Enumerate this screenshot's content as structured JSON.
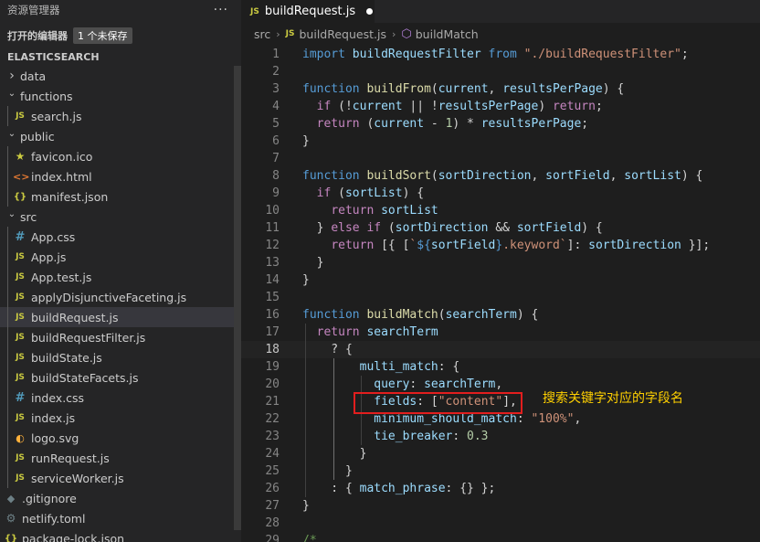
{
  "sidebar": {
    "title": "资源管理器",
    "more": "···",
    "open_editors": "打开的编辑器",
    "unsaved_badge": "1 个未保存",
    "project": "ELASTICSEARCH",
    "items": [
      {
        "label": "data",
        "type": "folder",
        "open": false,
        "depth": 0
      },
      {
        "label": "functions",
        "type": "folder",
        "open": true,
        "depth": 0
      },
      {
        "label": "search.js",
        "type": "js",
        "depth": 1
      },
      {
        "label": "public",
        "type": "folder",
        "open": true,
        "depth": 0
      },
      {
        "label": "favicon.ico",
        "type": "star",
        "depth": 1
      },
      {
        "label": "index.html",
        "type": "html",
        "depth": 1
      },
      {
        "label": "manifest.json",
        "type": "json",
        "depth": 1
      },
      {
        "label": "src",
        "type": "folder",
        "open": true,
        "depth": 0
      },
      {
        "label": "App.css",
        "type": "css",
        "depth": 1
      },
      {
        "label": "App.js",
        "type": "js",
        "depth": 1
      },
      {
        "label": "App.test.js",
        "type": "js",
        "depth": 1
      },
      {
        "label": "applyDisjunctiveFaceting.js",
        "type": "js",
        "depth": 1
      },
      {
        "label": "buildRequest.js",
        "type": "js",
        "depth": 1,
        "selected": true
      },
      {
        "label": "buildRequestFilter.js",
        "type": "js",
        "depth": 1
      },
      {
        "label": "buildState.js",
        "type": "js",
        "depth": 1
      },
      {
        "label": "buildStateFacets.js",
        "type": "js",
        "depth": 1
      },
      {
        "label": "index.css",
        "type": "css",
        "depth": 1
      },
      {
        "label": "index.js",
        "type": "js",
        "depth": 1
      },
      {
        "label": "logo.svg",
        "type": "svg",
        "depth": 1
      },
      {
        "label": "runRequest.js",
        "type": "js",
        "depth": 1
      },
      {
        "label": "serviceWorker.js",
        "type": "js",
        "depth": 1
      },
      {
        "label": ".gitignore",
        "type": "git",
        "depth": 0
      },
      {
        "label": "netlify.toml",
        "type": "gear",
        "depth": 0
      },
      {
        "label": "package-lock.json",
        "type": "json",
        "depth": 0
      }
    ]
  },
  "editor": {
    "tab_label": "buildRequest.js",
    "breadcrumb": [
      "src",
      "buildRequest.js",
      "buildMatch"
    ],
    "current_line": 18,
    "annotation": "搜索关键字对应的字段名",
    "lines": [
      [
        [
          "kw",
          "import"
        ],
        [
          "pl",
          " "
        ],
        [
          "var",
          "buildRequestFilter"
        ],
        [
          "pl",
          " "
        ],
        [
          "kw",
          "from"
        ],
        [
          "pl",
          " "
        ],
        [
          "str",
          "\"./buildRequestFilter\""
        ],
        [
          "pl",
          ";"
        ]
      ],
      [],
      [
        [
          "kw",
          "function"
        ],
        [
          "pl",
          " "
        ],
        [
          "fn",
          "buildFrom"
        ],
        [
          "pl",
          "("
        ],
        [
          "var",
          "current"
        ],
        [
          "pl",
          ", "
        ],
        [
          "var",
          "resultsPerPage"
        ],
        [
          "pl",
          ") {"
        ]
      ],
      [
        [
          "pl",
          "  "
        ],
        [
          "cf",
          "if"
        ],
        [
          "pl",
          " (!"
        ],
        [
          "var",
          "current"
        ],
        [
          "pl",
          " || !"
        ],
        [
          "var",
          "resultsPerPage"
        ],
        [
          "pl",
          ") "
        ],
        [
          "cf",
          "return"
        ],
        [
          "pl",
          ";"
        ]
      ],
      [
        [
          "pl",
          "  "
        ],
        [
          "cf",
          "return"
        ],
        [
          "pl",
          " ("
        ],
        [
          "var",
          "current"
        ],
        [
          "pl",
          " - "
        ],
        [
          "num",
          "1"
        ],
        [
          "pl",
          ") * "
        ],
        [
          "var",
          "resultsPerPage"
        ],
        [
          "pl",
          ";"
        ]
      ],
      [
        [
          "pl",
          "}"
        ]
      ],
      [],
      [
        [
          "kw",
          "function"
        ],
        [
          "pl",
          " "
        ],
        [
          "fn",
          "buildSort"
        ],
        [
          "pl",
          "("
        ],
        [
          "var",
          "sortDirection"
        ],
        [
          "pl",
          ", "
        ],
        [
          "var",
          "sortField"
        ],
        [
          "pl",
          ", "
        ],
        [
          "var",
          "sortList"
        ],
        [
          "pl",
          ") {"
        ]
      ],
      [
        [
          "pl",
          "  "
        ],
        [
          "cf",
          "if"
        ],
        [
          "pl",
          " ("
        ],
        [
          "var",
          "sortList"
        ],
        [
          "pl",
          ") {"
        ]
      ],
      [
        [
          "pl",
          "    "
        ],
        [
          "cf",
          "return"
        ],
        [
          "pl",
          " "
        ],
        [
          "var",
          "sortList"
        ]
      ],
      [
        [
          "pl",
          "  } "
        ],
        [
          "cf",
          "else"
        ],
        [
          "pl",
          " "
        ],
        [
          "cf",
          "if"
        ],
        [
          "pl",
          " ("
        ],
        [
          "var",
          "sortDirection"
        ],
        [
          "pl",
          " && "
        ],
        [
          "var",
          "sortField"
        ],
        [
          "pl",
          ") {"
        ]
      ],
      [
        [
          "pl",
          "    "
        ],
        [
          "cf",
          "return"
        ],
        [
          "pl",
          " [{ ["
        ],
        [
          "str",
          "`"
        ],
        [
          "kw",
          "${"
        ],
        [
          "var",
          "sortField"
        ],
        [
          "kw",
          "}"
        ],
        [
          "str",
          ".keyword`"
        ],
        [
          "pl",
          "]: "
        ],
        [
          "var",
          "sortDirection"
        ],
        [
          "pl",
          " }];"
        ]
      ],
      [
        [
          "pl",
          "  }"
        ]
      ],
      [
        [
          "pl",
          "}"
        ]
      ],
      [],
      [
        [
          "kw",
          "function"
        ],
        [
          "pl",
          " "
        ],
        [
          "fn",
          "buildMatch"
        ],
        [
          "pl",
          "("
        ],
        [
          "var",
          "searchTerm"
        ],
        [
          "pl",
          ") {"
        ]
      ],
      [
        [
          "pl",
          "  "
        ],
        [
          "cf",
          "return"
        ],
        [
          "pl",
          " "
        ],
        [
          "var",
          "searchTerm"
        ]
      ],
      [
        [
          "pl",
          "    ? {"
        ]
      ],
      [
        [
          "pl",
          "        "
        ],
        [
          "var",
          "multi_match"
        ],
        [
          "pl",
          ": {"
        ]
      ],
      [
        [
          "pl",
          "          "
        ],
        [
          "var",
          "query"
        ],
        [
          "pl",
          ": "
        ],
        [
          "var",
          "searchTerm"
        ],
        [
          "pl",
          ","
        ]
      ],
      [
        [
          "pl",
          "          "
        ],
        [
          "var",
          "fields"
        ],
        [
          "pl",
          ": ["
        ],
        [
          "str",
          "\"content\""
        ],
        [
          "pl",
          "],"
        ]
      ],
      [
        [
          "pl",
          "          "
        ],
        [
          "var",
          "minimum_should_match"
        ],
        [
          "pl",
          ": "
        ],
        [
          "str",
          "\"100%\""
        ],
        [
          "pl",
          ","
        ]
      ],
      [
        [
          "pl",
          "          "
        ],
        [
          "var",
          "tie_breaker"
        ],
        [
          "pl",
          ": "
        ],
        [
          "num",
          "0.3"
        ]
      ],
      [
        [
          "pl",
          "        }"
        ]
      ],
      [
        [
          "pl",
          "      }"
        ]
      ],
      [
        [
          "pl",
          "    : { "
        ],
        [
          "var",
          "match_phrase"
        ],
        [
          "pl",
          ": {} };"
        ]
      ],
      [
        [
          "pl",
          "}"
        ]
      ],
      [],
      [
        [
          "cm",
          "/*"
        ]
      ]
    ]
  },
  "colors": {
    "highlight_box": "#e21e1e",
    "annotation_text": "#ffd000"
  }
}
